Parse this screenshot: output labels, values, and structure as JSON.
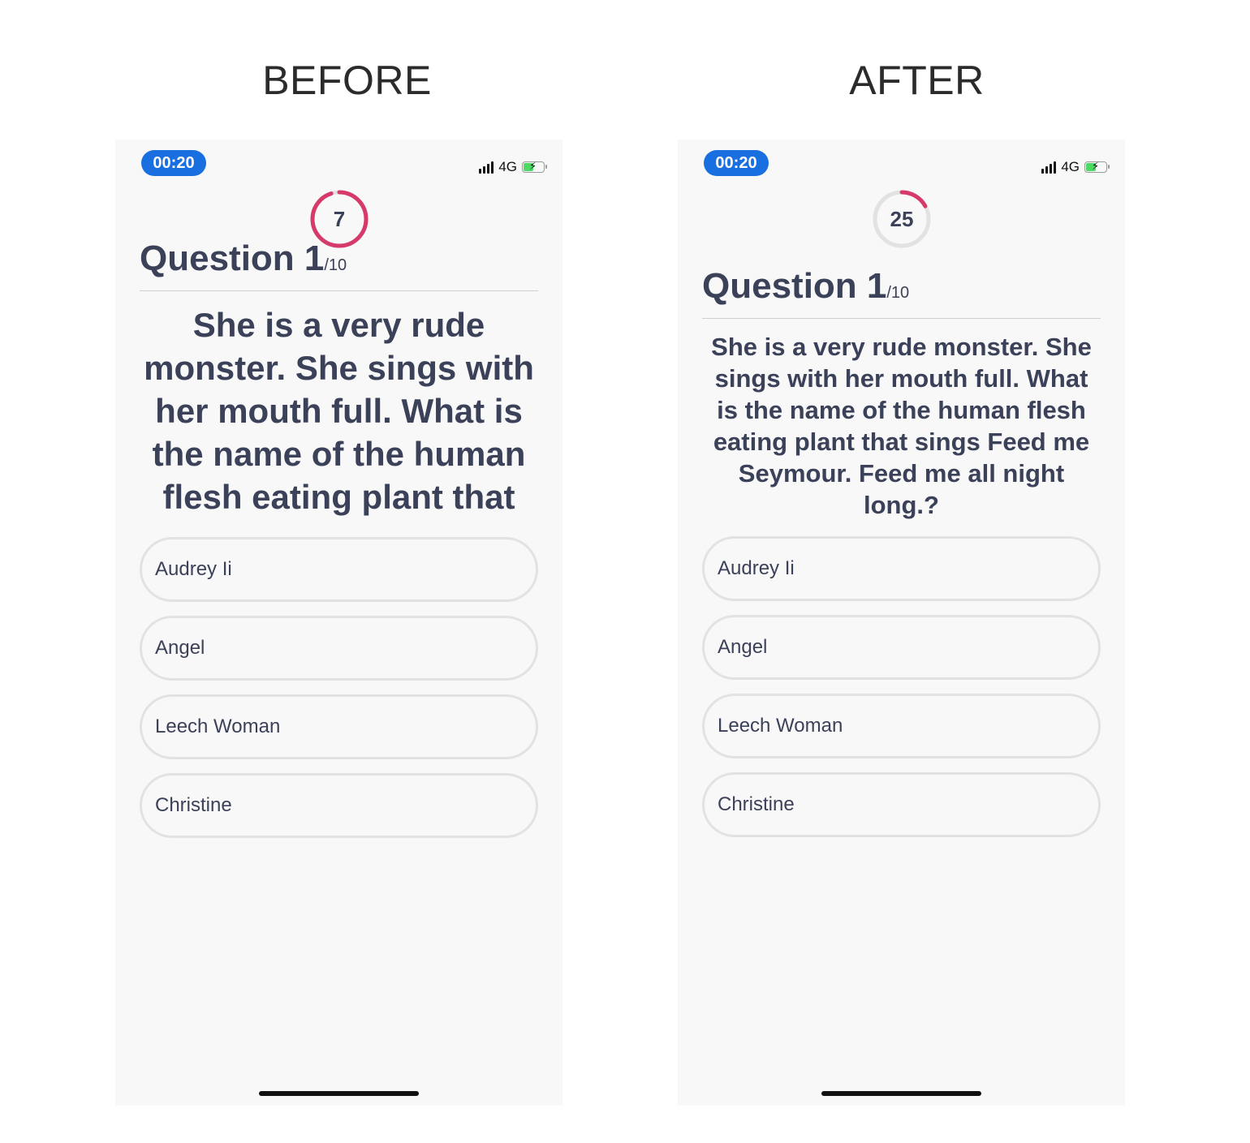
{
  "before": {
    "label": "BEFORE",
    "status": {
      "time": "00:20",
      "network": "4G",
      "battery_level": 0.45,
      "signal_bars": 4
    },
    "timer": {
      "value": "7",
      "progress": 0.95
    },
    "question": {
      "title": "Question 1",
      "total": "/10",
      "text": "She is a very rude monster.  She sings with her mouth full. What is the name of the human flesh eating plant that sings Feed me Seymour. Feed me all night long.?"
    },
    "answers": [
      "Audrey Ii",
      "Angel",
      "Leech Woman",
      "Christine"
    ]
  },
  "after": {
    "label": "AFTER",
    "status": {
      "time": "00:20",
      "network": "4G",
      "battery_level": 0.45,
      "signal_bars": 4
    },
    "timer": {
      "value": "25",
      "progress": 0.17
    },
    "question": {
      "title": "Question 1",
      "total": "/10",
      "text": "She is a very rude monster.  She sings with her mouth full. What is the name of the human flesh eating plant that sings Feed me Seymour. Feed me all night long.?"
    },
    "answers": [
      "Audrey Ii",
      "Angel",
      "Leech Woman",
      "Christine"
    ]
  },
  "colors": {
    "accent": "#d63a6a",
    "ring_track": "#e2e2e2",
    "time_pill": "#1a6fe0",
    "text": "#3a4158",
    "battery": "#4cd964"
  }
}
